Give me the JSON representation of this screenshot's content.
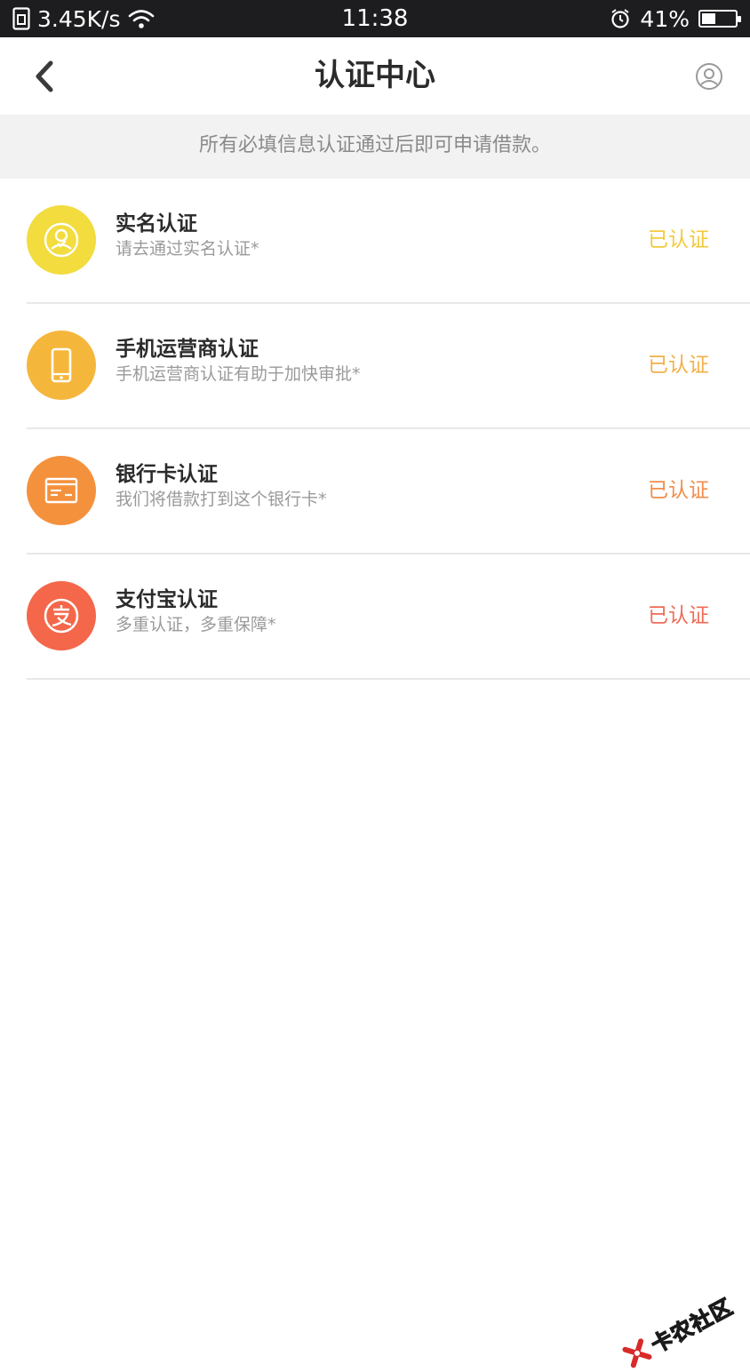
{
  "status_bar": {
    "speed": "3.45K/s",
    "time": "11:38",
    "battery": "41%",
    "battery_level": 0.41
  },
  "nav": {
    "title": "认证中心",
    "back_icon": "chevron-left-icon",
    "user_icon": "user-circle-icon"
  },
  "notice": "所有必填信息认证通过后即可申请借款。",
  "items": [
    {
      "title": "实名认证",
      "sub": "请去通过实名认证*",
      "status": "已认证",
      "color": "#f2dc3e",
      "status_color": "#f3c93a",
      "icon": "face-id-icon"
    },
    {
      "title": "手机运营商认证",
      "sub": "手机运营商认证有助于加快审批*",
      "status": "已认证",
      "color": "#f5b63c",
      "status_color": "#f2b04a",
      "icon": "phone-icon"
    },
    {
      "title": "银行卡认证",
      "sub": "我们将借款打到这个银行卡*",
      "status": "已认证",
      "color": "#f4913d",
      "status_color": "#f18d4b",
      "icon": "bank-card-icon"
    },
    {
      "title": "支付宝认证",
      "sub": "多重认证，多重保障*",
      "status": "已认证",
      "color": "#f4674a",
      "status_color": "#ef6b55",
      "icon": "alipay-icon"
    }
  ],
  "watermark": "卡农社区"
}
